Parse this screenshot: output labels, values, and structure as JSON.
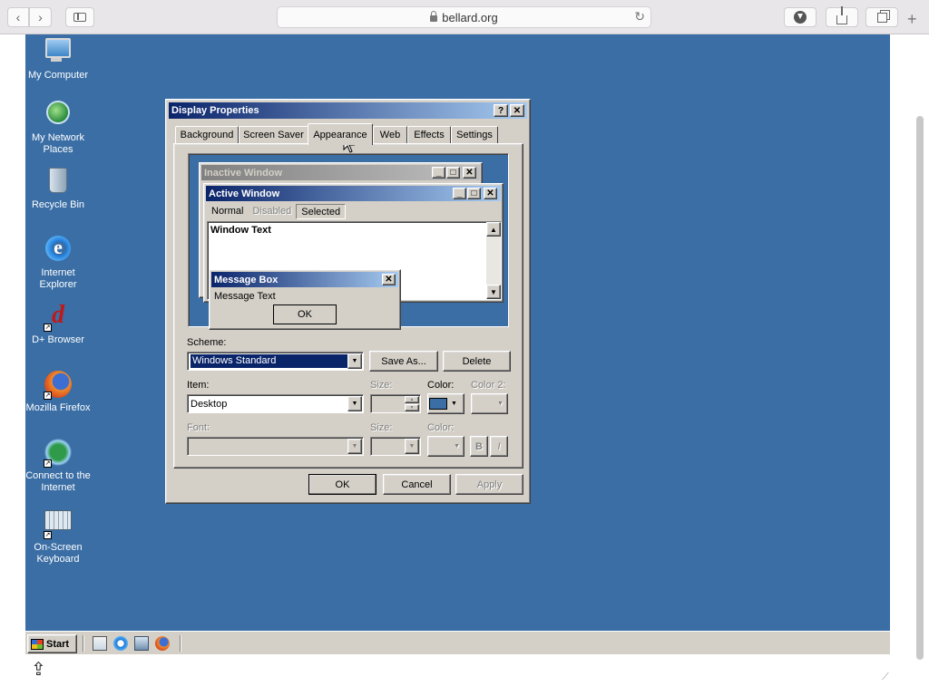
{
  "browser": {
    "url": "bellard.org",
    "back_glyph": "‹",
    "forward_glyph": "›",
    "new_tab_glyph": "+",
    "reload_glyph": "↻",
    "icons": [
      "back-icon",
      "forward-icon",
      "sidebar-icon",
      "lock-icon",
      "reload-icon",
      "download-icon",
      "share-icon",
      "tabs-icon",
      "plus-icon",
      "upload-icon",
      "resize-grip-icon"
    ]
  },
  "desktop": {
    "background_color": "#3a6ea5",
    "icons": [
      {
        "label": "My Computer",
        "icon": "my-computer-icon"
      },
      {
        "label": "My Network Places",
        "icon": "network-places-icon"
      },
      {
        "label": "Recycle Bin",
        "icon": "recycle-bin-icon"
      },
      {
        "label": "Internet Explorer",
        "icon": "internet-explorer-icon"
      },
      {
        "label": "D+ Browser",
        "icon": "dplus-browser-icon"
      },
      {
        "label": "Mozilla Firefox",
        "icon": "firefox-icon"
      },
      {
        "label": "Connect to the Internet",
        "icon": "connect-internet-icon"
      },
      {
        "label": "On-Screen Keyboard",
        "icon": "onscreen-keyboard-icon"
      }
    ]
  },
  "dialog": {
    "title": "Display Properties",
    "help_glyph": "?",
    "close_glyph": "✕",
    "tabs": [
      "Background",
      "Screen Saver",
      "Appearance",
      "Web",
      "Effects",
      "Settings"
    ],
    "selected_tab": "Appearance",
    "preview": {
      "inactive_title": "Inactive Window",
      "active_title": "Active Window",
      "menu_normal": "Normal",
      "menu_disabled": "Disabled",
      "menu_selected": "Selected",
      "window_text": "Window Text",
      "msgbox_title": "Message Box",
      "msgbox_text": "Message Text",
      "msgbox_ok": "OK"
    },
    "scheme_label": "Scheme:",
    "scheme_value": "Windows Standard",
    "save_as_label": "Save As...",
    "delete_label": "Delete",
    "item_label": "Item:",
    "item_value": "Desktop",
    "item_size_label": "Size:",
    "item_color_label": "Color:",
    "item_color2_label": "Color 2:",
    "font_label": "Font:",
    "font_size_label": "Size:",
    "font_color_label": "Color:",
    "bold_label": "B",
    "italic_label": "I",
    "desktop_color": "#3a6ea5",
    "ok_label": "OK",
    "cancel_label": "Cancel",
    "apply_label": "Apply"
  },
  "taskbar": {
    "start_label": "Start",
    "quick_launch": [
      "show-desktop-icon",
      "internet-explorer-icon",
      "network-icon",
      "firefox-icon"
    ]
  }
}
